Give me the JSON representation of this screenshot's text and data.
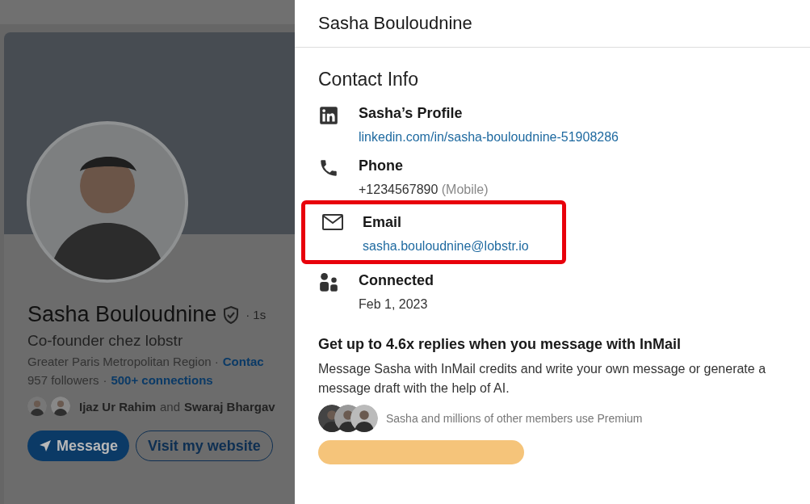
{
  "profile": {
    "name": "Sasha Bouloudnine",
    "degree": "· 1s",
    "headline": "Co-founder chez lobstr",
    "location": "Greater Paris Metropolitan Region ·",
    "contact_link": "Contac",
    "followers": "957 followers",
    "connections_sep": "·",
    "connections": "500+ connections",
    "mutual_a": "Ijaz Ur Rahim",
    "mutual_and": "and",
    "mutual_b": "Swaraj Bhargav",
    "buttons": [
      {
        "label": "Message",
        "kind": "primary"
      },
      {
        "label": "Visit my website",
        "kind": "outline"
      }
    ]
  },
  "panel": {
    "title": "Sasha Bouloudnine",
    "section": "Contact Info",
    "items": [
      {
        "kind": "linkedin",
        "label": "Sasha’s Profile",
        "value": "linkedin.com/in/sasha-bouloudnine-51908286",
        "link": true,
        "highlighted": false
      },
      {
        "kind": "phone",
        "label": "Phone",
        "value": "+1234567890",
        "note": "(Mobile)",
        "link": false,
        "highlighted": false
      },
      {
        "kind": "email",
        "label": "Email",
        "value": "sasha.bouloudnine@lobstr.io",
        "link": true,
        "highlighted": true
      },
      {
        "kind": "connected",
        "label": "Connected",
        "value": "Feb 1, 2023",
        "link": false,
        "highlighted": false
      }
    ],
    "promo": {
      "title": "Get up to 4.6x replies when you message with InMail",
      "body": "Message Sasha with InMail credits and write your own message or generate a message draft with the help of AI.",
      "members": "Sasha and millions of other members use Premium"
    }
  }
}
